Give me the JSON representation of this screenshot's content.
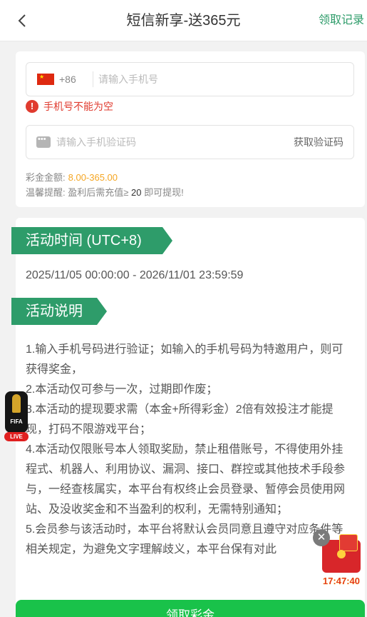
{
  "header": {
    "title": "短信新享-送365元",
    "records_link": "领取记录"
  },
  "form": {
    "country_code": "+86",
    "phone_placeholder": "请输入手机号",
    "phone_error": "手机号不能为空",
    "code_placeholder": "请输入手机验证码",
    "get_code_label": "获取验证码",
    "amount_label": "彩金金额:",
    "amount_value": "8.00-365.00",
    "tip_prefix": "温馨提醒: 盈利后需充值≥",
    "tip_amount": "20",
    "tip_suffix": "即可提现!"
  },
  "activity": {
    "time_heading": "活动时间 (UTC+8)",
    "time_range": "2025/11/05 00:00:00 - 2026/11/01 23:59:59",
    "desc_heading": "活动说明",
    "desc_items": [
      "1.输入手机号码进行验证；如输入的手机号码为特邀用户，则可获得奖金，",
      "2.本活动仅可参与一次，过期即作废；",
      "3.本活动的提现要求需（本金+所得彩金）2倍有效投注才能提现，打码不限游戏平台；",
      "4.本活动仅限账号本人领取奖励，禁止租借账号，不得使用外挂程式、机器人、利用协议、漏洞、接口、群控或其他技术手段参与，一经查核属实，本平台有权终止会员登录、暂停会员使用网站、及没收奖金和不当盈利的权利，无需特别通知；",
      "5.会员参与该活动时，本平台将默认会员同意且遵守对应条件等相关规定，为避免文字理解歧义，本平台保有对此"
    ]
  },
  "floats": {
    "fifa_label": "FIFA",
    "live_label": "LIVE",
    "close_glyph": "✕",
    "redpack_time": "17:47:40"
  },
  "bottom_button": "领取彩金",
  "colors": {
    "accent_green": "#2e9c6a",
    "button_green": "#19c24a",
    "error_red": "#e03b2f",
    "amount_orange": "#f5a623"
  },
  "icons": [
    "back-arrow-icon",
    "china-flag-icon",
    "error-icon",
    "sms-icon",
    "fifa-trophy-icon",
    "close-icon",
    "red-packet-icon"
  ]
}
